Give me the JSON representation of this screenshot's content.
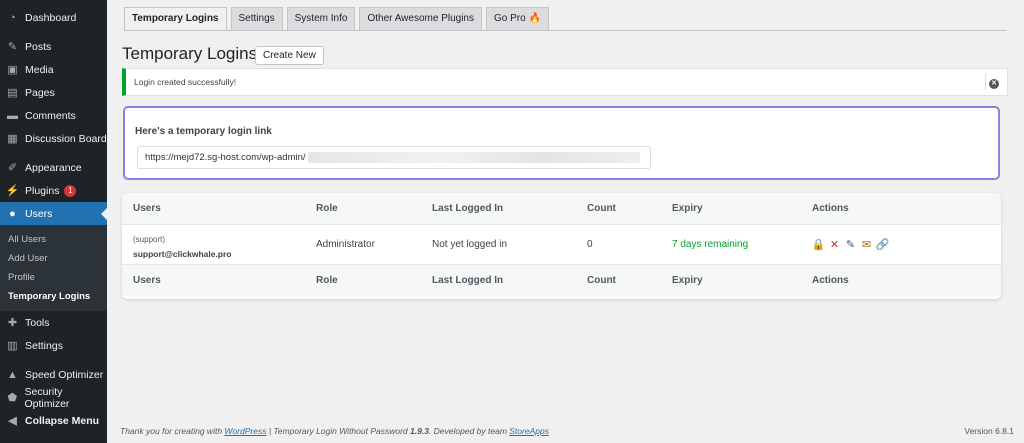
{
  "sidebar": {
    "items_top": [
      {
        "label": "Dashboard",
        "icon": "dashboard-icon",
        "glyph": "◔"
      }
    ],
    "items_mid": [
      {
        "label": "Posts",
        "icon": "pin-icon",
        "glyph": "✎"
      },
      {
        "label": "Media",
        "icon": "media-icon",
        "glyph": "▣"
      },
      {
        "label": "Pages",
        "icon": "page-icon",
        "glyph": "▤"
      },
      {
        "label": "Comments",
        "icon": "comment-icon",
        "glyph": "▬"
      },
      {
        "label": "Discussion Board",
        "icon": "board-icon",
        "glyph": "▦"
      }
    ],
    "items_low": [
      {
        "label": "Appearance",
        "icon": "brush-icon",
        "glyph": "✐"
      },
      {
        "label": "Plugins",
        "icon": "plugin-icon",
        "glyph": "⚡",
        "badge": "1"
      },
      {
        "label": "Users",
        "icon": "user-icon",
        "glyph": "●",
        "active": true
      }
    ],
    "submenu": [
      {
        "label": "All Users"
      },
      {
        "label": "Add User"
      },
      {
        "label": "Profile"
      },
      {
        "label": "Temporary Logins",
        "current": true
      }
    ],
    "items_bottom": [
      {
        "label": "Tools",
        "icon": "wrench-icon",
        "glyph": "✚"
      },
      {
        "label": "Settings",
        "icon": "settings-icon",
        "glyph": "▥"
      }
    ],
    "items_extra": [
      {
        "label": "Speed Optimizer",
        "icon": "speed-icon",
        "glyph": "▲"
      },
      {
        "label": "Security Optimizer",
        "icon": "shield-icon",
        "glyph": "⬟"
      },
      {
        "label": "Collapse Menu",
        "icon": "collapse-icon",
        "glyph": "◀"
      }
    ]
  },
  "tabs": [
    {
      "label": "Temporary Logins",
      "active": true
    },
    {
      "label": "Settings"
    },
    {
      "label": "System Info"
    },
    {
      "label": "Other Awesome Plugins"
    },
    {
      "label": "Go Pro 🔥"
    }
  ],
  "page": {
    "title": "Temporary Logins",
    "create_button": "Create New"
  },
  "notice": {
    "message": "Login created successfully!",
    "color": "#00a32a"
  },
  "link_box": {
    "label": "Here's a temporary login link",
    "url_visible": "https://mejd72.sg-host.com/wp-admin/"
  },
  "table": {
    "headers": [
      "Users",
      "Role",
      "Last Logged In",
      "Count",
      "Expiry",
      "Actions"
    ],
    "rows": [
      {
        "user_name": "(support)",
        "user_email": "support@clickwhale.pro",
        "role": "Administrator",
        "last_logged_in": "Not yet logged in",
        "count": "0",
        "expiry": "7 days remaining",
        "actions": [
          {
            "icon": "lock-icon",
            "glyph": "🔒",
            "color": "#00a32a"
          },
          {
            "icon": "delete-icon",
            "glyph": "✕",
            "color": "#d63638"
          },
          {
            "icon": "edit-icon",
            "glyph": "✎",
            "color": "#50575e"
          },
          {
            "icon": "email-icon",
            "glyph": "✉",
            "color": "#b26200"
          },
          {
            "icon": "link-icon",
            "glyph": "🔗",
            "color": "#7b61ff"
          }
        ]
      }
    ]
  },
  "footer": {
    "thanks_prefix": "Thank you for creating with ",
    "wordpress_link": "WordPress",
    "sep": " | Temporary Login Without Password ",
    "version_plugin": "1.9.3",
    "developed": ". Developed by team ",
    "storeapps_link": "StoreApps",
    "version": "Version 6.8.1"
  }
}
